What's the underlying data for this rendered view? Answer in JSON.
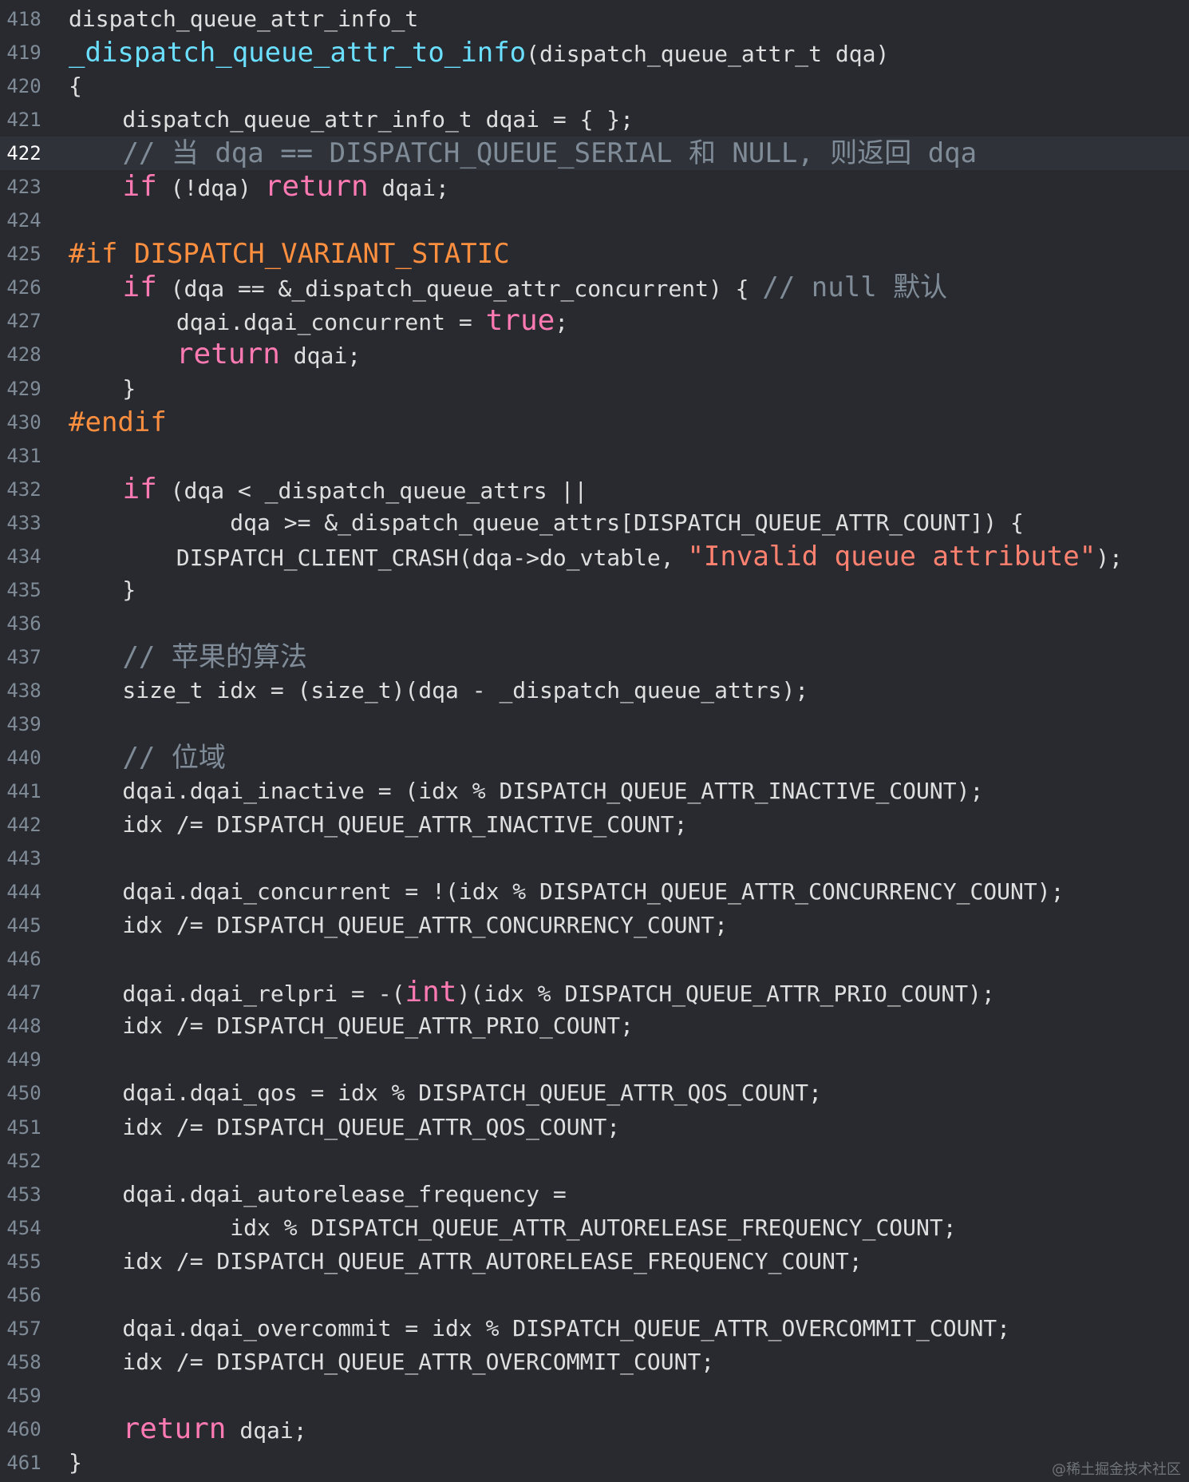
{
  "editor": {
    "colors": {
      "background": "#292a30",
      "current_line_background": "#2f3239",
      "line_number": "#7f8c98",
      "current_line_number": "#ffffff",
      "plain": "#dfdfe0",
      "keyword": "#ff7ab2",
      "function": "#6bdfff",
      "comment": "#7f8c98",
      "preprocessor": "#fd8f3f",
      "string": "#ff8170"
    },
    "current_line": 422,
    "lines": [
      {
        "number": "418",
        "tokens": [
          {
            "text": "dispatch_queue_attr_info_t",
            "kind": "plain"
          }
        ]
      },
      {
        "number": "419",
        "tokens": [
          {
            "text": "_dispatch_queue_attr_to_info",
            "kind": "func"
          },
          {
            "text": "(dispatch_queue_attr_t dqa)",
            "kind": "plain"
          }
        ]
      },
      {
        "number": "420",
        "tokens": [
          {
            "text": "{",
            "kind": "plain"
          }
        ]
      },
      {
        "number": "421",
        "tokens": [
          {
            "text": "    dispatch_queue_attr_info_t dqai = { };",
            "kind": "plain"
          }
        ]
      },
      {
        "number": "422",
        "tokens": [
          {
            "text": "    ",
            "kind": "plain"
          },
          {
            "text": "// 当 dqa == DISPATCH_QUEUE_SERIAL 和 NULL, 则返回 dqa",
            "kind": "comment"
          }
        ]
      },
      {
        "number": "423",
        "tokens": [
          {
            "text": "    ",
            "kind": "plain"
          },
          {
            "text": "if",
            "kind": "keyword"
          },
          {
            "text": " (!dqa) ",
            "kind": "plain"
          },
          {
            "text": "return",
            "kind": "keyword"
          },
          {
            "text": " dqai;",
            "kind": "plain"
          }
        ]
      },
      {
        "number": "424",
        "tokens": []
      },
      {
        "number": "425",
        "tokens": [
          {
            "text": "#if DISPATCH_VARIANT_STATIC",
            "kind": "preproc"
          }
        ]
      },
      {
        "number": "426",
        "tokens": [
          {
            "text": "    ",
            "kind": "plain"
          },
          {
            "text": "if",
            "kind": "keyword"
          },
          {
            "text": " (dqa == &_dispatch_queue_attr_concurrent) { ",
            "kind": "plain"
          },
          {
            "text": "// null 默认",
            "kind": "comment"
          }
        ]
      },
      {
        "number": "427",
        "tokens": [
          {
            "text": "        dqai.dqai_concurrent = ",
            "kind": "plain"
          },
          {
            "text": "true",
            "kind": "keyword"
          },
          {
            "text": ";",
            "kind": "plain"
          }
        ]
      },
      {
        "number": "428",
        "tokens": [
          {
            "text": "        ",
            "kind": "plain"
          },
          {
            "text": "return",
            "kind": "keyword"
          },
          {
            "text": " dqai;",
            "kind": "plain"
          }
        ]
      },
      {
        "number": "429",
        "tokens": [
          {
            "text": "    }",
            "kind": "plain"
          }
        ]
      },
      {
        "number": "430",
        "tokens": [
          {
            "text": "#endif",
            "kind": "preproc"
          }
        ]
      },
      {
        "number": "431",
        "tokens": []
      },
      {
        "number": "432",
        "tokens": [
          {
            "text": "    ",
            "kind": "plain"
          },
          {
            "text": "if",
            "kind": "keyword"
          },
          {
            "text": " (dqa < _dispatch_queue_attrs ||",
            "kind": "plain"
          }
        ]
      },
      {
        "number": "433",
        "tokens": [
          {
            "text": "            dqa >= &_dispatch_queue_attrs[DISPATCH_QUEUE_ATTR_COUNT]) {",
            "kind": "plain"
          }
        ]
      },
      {
        "number": "434",
        "tokens": [
          {
            "text": "        DISPATCH_CLIENT_CRASH(dqa->do_vtable, ",
            "kind": "plain"
          },
          {
            "text": "\"Invalid queue attribute\"",
            "kind": "string"
          },
          {
            "text": ");",
            "kind": "plain"
          }
        ]
      },
      {
        "number": "435",
        "tokens": [
          {
            "text": "    }",
            "kind": "plain"
          }
        ]
      },
      {
        "number": "436",
        "tokens": []
      },
      {
        "number": "437",
        "tokens": [
          {
            "text": "    ",
            "kind": "plain"
          },
          {
            "text": "// 苹果的算法",
            "kind": "comment"
          }
        ]
      },
      {
        "number": "438",
        "tokens": [
          {
            "text": "    size_t idx = (size_t)(dqa - _dispatch_queue_attrs);",
            "kind": "plain"
          }
        ]
      },
      {
        "number": "439",
        "tokens": []
      },
      {
        "number": "440",
        "tokens": [
          {
            "text": "    ",
            "kind": "plain"
          },
          {
            "text": "// 位域",
            "kind": "comment"
          }
        ]
      },
      {
        "number": "441",
        "tokens": [
          {
            "text": "    dqai.dqai_inactive = (idx % DISPATCH_QUEUE_ATTR_INACTIVE_COUNT);",
            "kind": "plain"
          }
        ]
      },
      {
        "number": "442",
        "tokens": [
          {
            "text": "    idx /= DISPATCH_QUEUE_ATTR_INACTIVE_COUNT;",
            "kind": "plain"
          }
        ]
      },
      {
        "number": "443",
        "tokens": []
      },
      {
        "number": "444",
        "tokens": [
          {
            "text": "    dqai.dqai_concurrent = !(idx % DISPATCH_QUEUE_ATTR_CONCURRENCY_COUNT);",
            "kind": "plain"
          }
        ]
      },
      {
        "number": "445",
        "tokens": [
          {
            "text": "    idx /= DISPATCH_QUEUE_ATTR_CONCURRENCY_COUNT;",
            "kind": "plain"
          }
        ]
      },
      {
        "number": "446",
        "tokens": []
      },
      {
        "number": "447",
        "tokens": [
          {
            "text": "    dqai.dqai_relpri = -(",
            "kind": "plain"
          },
          {
            "text": "int",
            "kind": "keyword"
          },
          {
            "text": ")(idx % DISPATCH_QUEUE_ATTR_PRIO_COUNT);",
            "kind": "plain"
          }
        ]
      },
      {
        "number": "448",
        "tokens": [
          {
            "text": "    idx /= DISPATCH_QUEUE_ATTR_PRIO_COUNT;",
            "kind": "plain"
          }
        ]
      },
      {
        "number": "449",
        "tokens": []
      },
      {
        "number": "450",
        "tokens": [
          {
            "text": "    dqai.dqai_qos = idx % DISPATCH_QUEUE_ATTR_QOS_COUNT;",
            "kind": "plain"
          }
        ]
      },
      {
        "number": "451",
        "tokens": [
          {
            "text": "    idx /= DISPATCH_QUEUE_ATTR_QOS_COUNT;",
            "kind": "plain"
          }
        ]
      },
      {
        "number": "452",
        "tokens": []
      },
      {
        "number": "453",
        "tokens": [
          {
            "text": "    dqai.dqai_autorelease_frequency =",
            "kind": "plain"
          }
        ]
      },
      {
        "number": "454",
        "tokens": [
          {
            "text": "            idx % DISPATCH_QUEUE_ATTR_AUTORELEASE_FREQUENCY_COUNT;",
            "kind": "plain"
          }
        ]
      },
      {
        "number": "455",
        "tokens": [
          {
            "text": "    idx /= DISPATCH_QUEUE_ATTR_AUTORELEASE_FREQUENCY_COUNT;",
            "kind": "plain"
          }
        ]
      },
      {
        "number": "456",
        "tokens": []
      },
      {
        "number": "457",
        "tokens": [
          {
            "text": "    dqai.dqai_overcommit = idx % DISPATCH_QUEUE_ATTR_OVERCOMMIT_COUNT;",
            "kind": "plain"
          }
        ]
      },
      {
        "number": "458",
        "tokens": [
          {
            "text": "    idx /= DISPATCH_QUEUE_ATTR_OVERCOMMIT_COUNT;",
            "kind": "plain"
          }
        ]
      },
      {
        "number": "459",
        "tokens": []
      },
      {
        "number": "460",
        "tokens": [
          {
            "text": "    ",
            "kind": "plain"
          },
          {
            "text": "return",
            "kind": "keyword"
          },
          {
            "text": " dqai;",
            "kind": "plain"
          }
        ]
      },
      {
        "number": "461",
        "tokens": [
          {
            "text": "}",
            "kind": "plain"
          }
        ]
      }
    ]
  },
  "watermark": "@稀土掘金技术社区"
}
